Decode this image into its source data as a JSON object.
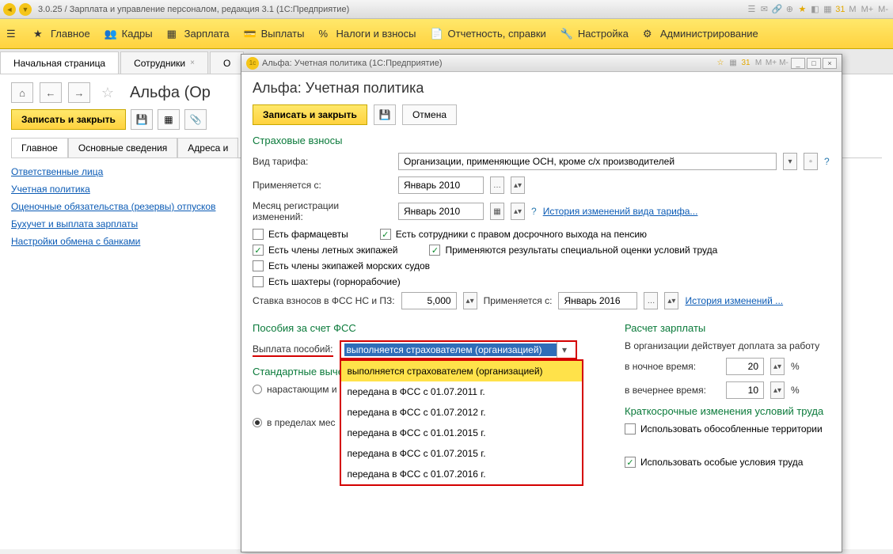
{
  "titlebar": {
    "text": "3.0.25 / Зарплата и управление персоналом, редакция 3.1  (1С:Предприятие)"
  },
  "titlebar_icons": [
    "M",
    "M+",
    "M-"
  ],
  "menu": {
    "items": [
      {
        "label": "Главное"
      },
      {
        "label": "Кадры"
      },
      {
        "label": "Зарплата"
      },
      {
        "label": "Выплаты"
      },
      {
        "label": "Налоги и взносы"
      },
      {
        "label": "Отчетность, справки"
      },
      {
        "label": "Настройка"
      },
      {
        "label": "Администрирование"
      }
    ]
  },
  "tabs": {
    "items": [
      {
        "label": "Начальная страница"
      },
      {
        "label": "Сотрудники"
      },
      {
        "label": "О"
      }
    ]
  },
  "page": {
    "title": "Альфа (Ор",
    "save_close": "Записать и закрыть",
    "subtabs": [
      {
        "label": "Главное"
      },
      {
        "label": "Основные сведения"
      },
      {
        "label": "Адреса и"
      }
    ],
    "links": [
      "Ответственные лица",
      "Учетная политика",
      "Оценочные обязательства (резервы) отпусков",
      "Бухучет и выплата зарплаты",
      "Настройки обмена с банками"
    ]
  },
  "dialog": {
    "title": "Альфа: Учетная политика  (1С:Предприятие)",
    "heading": "Альфа: Учетная политика",
    "save_close": "Записать и закрыть",
    "cancel": "Отмена",
    "section_insurance": "Страховые взносы",
    "tariff_label": "Вид тарифа:",
    "tariff_value": "Организации, применяющие ОСН, кроме с/х производителей",
    "applies_from_label": "Применяется с:",
    "applies_from_value": "Январь 2010",
    "reg_month_label": "Месяц регистрации изменений:",
    "reg_month_value": "Январь 2010",
    "history_link": "История изменений вида тарифа...",
    "chk_pharm": "Есть фармацевты",
    "chk_pension": "Есть сотрудники с правом досрочного выхода на пенсию",
    "chk_flight": "Есть члены летных экипажей",
    "chk_spec": "Применяются результаты специальной оценки условий труда",
    "chk_sea": "Есть члены экипажей морских судов",
    "chk_miners": "Есть шахтеры (горнорабочие)",
    "rate_label": "Ставка взносов в ФСС НС и ПЗ:",
    "rate_value": "5,000",
    "rate_applies_label": "Применяется с:",
    "rate_applies_value": "Январь 2016",
    "history2": "История изменений ...",
    "section_fss": "Пособия за счет ФСС",
    "payout_label": "Выплата пособий:",
    "dropdown": {
      "selected": "выполняется страхователем (организацией)",
      "items": [
        "выполняется страхователем (организацией)",
        "передана в ФСС с 01.07.2011 г.",
        "передана в ФСС с 01.07.2012 г.",
        "передана в ФСС с 01.01.2015 г.",
        "передана в ФСС с 01.07.2015 г.",
        "передана в ФСС с 01.07.2016 г."
      ]
    },
    "section_deduct": "Стандартные выче",
    "radio1": "нарастающим и",
    "radio2": "в пределах мес",
    "section_salary": "Расчет зарплаты",
    "salary_text": "В организации действует доплата за работу",
    "night_label": "в ночное время:",
    "night_value": "20",
    "evening_label": "в вечернее время:",
    "evening_value": "10",
    "percent": "%",
    "section_short": "Краткосрочные изменения условий труда",
    "chk_territories": "Использовать обособленные территории",
    "chk_conditions": "Использовать особые условия труда",
    "winbtns": [
      "M",
      "M+",
      "M-"
    ]
  }
}
